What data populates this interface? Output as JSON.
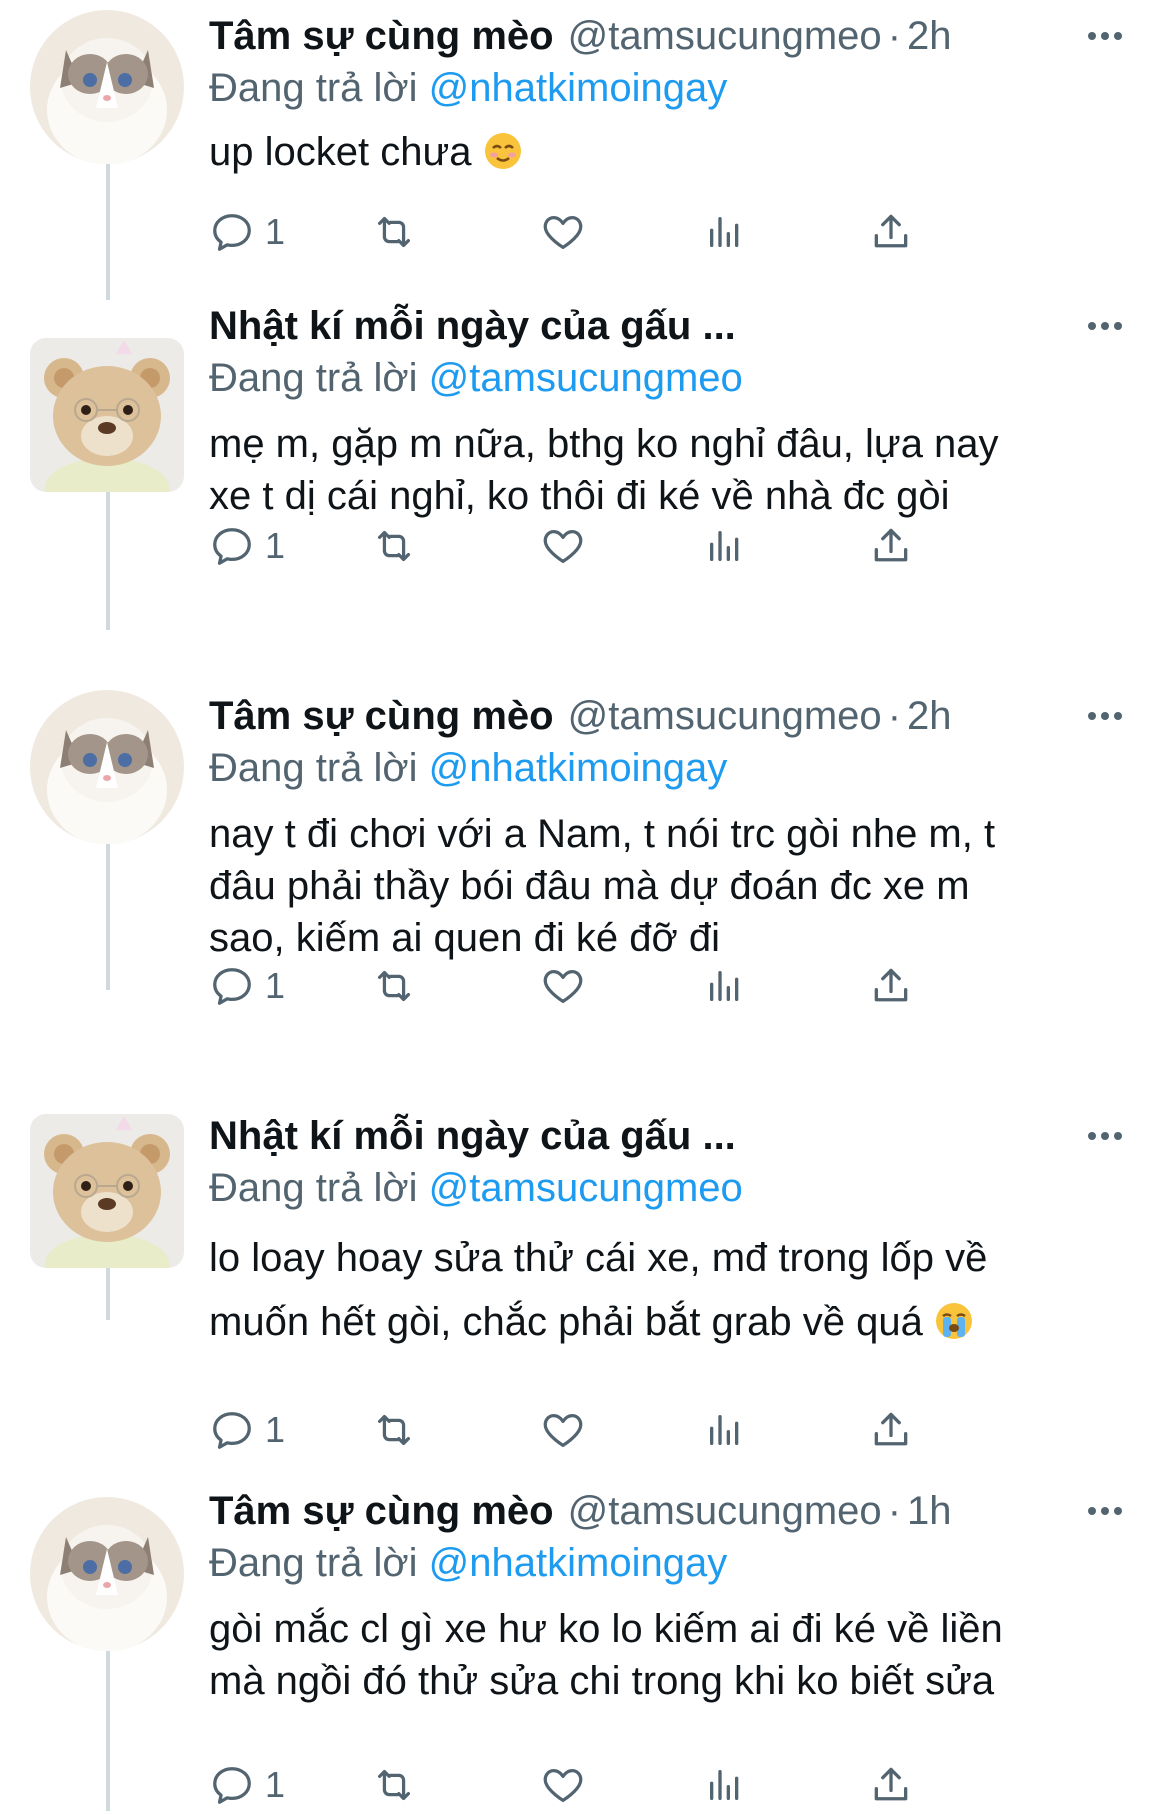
{
  "thread": [
    {
      "author_name": "Tâm sự cùng mèo",
      "author_handle": "@tamsucungmeo",
      "separator": "·",
      "time": "2h",
      "avatar": "cat",
      "reply_prefix": "Đang trả lời",
      "reply_to": "@nhatkimoingay",
      "text_lines": [
        "up locket chưa"
      ],
      "emoji": "smiling-blush-emoji",
      "reply_count": "1"
    },
    {
      "author_name": "Nhật kí mỗi ngày của gấu",
      "name_truncation": "...",
      "avatar": "bear",
      "reply_prefix": "Đang trả lời",
      "reply_to": "@tamsucungmeo",
      "text_lines": [
        "mẹ m, gặp m nữa, bthg ko nghỉ đâu, lựa nay",
        "xe t dị cái nghỉ, ko thôi đi ké về nhà đc gòi"
      ],
      "reply_count": "1"
    },
    {
      "author_name": "Tâm sự cùng mèo",
      "author_handle": "@tamsucungmeo",
      "separator": "·",
      "time": "2h",
      "avatar": "cat",
      "reply_prefix": "Đang trả lời",
      "reply_to": "@nhatkimoingay",
      "text_lines": [
        "nay t đi chơi với a Nam, t nói trc gòi nhe m, t",
        "đâu phải thầy bói đâu mà dự đoán đc xe m",
        "sao, kiếm ai quen đi ké đỡ đi"
      ],
      "reply_count": "1"
    },
    {
      "author_name": "Nhật kí mỗi ngày của gấu",
      "name_truncation": "...",
      "avatar": "bear",
      "reply_prefix": "Đang trả lời",
      "reply_to": "@tamsucungmeo",
      "text_lines": [
        "lo loay hoay sửa thử cái xe, mđ trong lốp về",
        "muốn hết gòi, chắc phải bắt grab về quá"
      ],
      "emoji": "loudly-crying-emoji",
      "reply_count": "1"
    },
    {
      "author_name": "Tâm sự cùng mèo",
      "author_handle": "@tamsucungmeo",
      "separator": "·",
      "time": "1h",
      "avatar": "cat",
      "reply_prefix": "Đang trả lời",
      "reply_to": "@nhatkimoingay",
      "text_lines": [
        "gòi mắc cl gì xe hư ko lo kiếm ai đi ké về liền",
        "mà ngồi đó thử sửa chi trong khi ko biết sửa"
      ],
      "reply_count": "1"
    }
  ],
  "icons": {
    "reply": "reply-bubble-icon",
    "retweet": "retweet-icon",
    "like": "heart-icon",
    "views": "analytics-bars-icon",
    "share": "share-upload-icon",
    "more": "more-dots-icon"
  },
  "colors": {
    "text": "#0f1419",
    "secondary": "#536471",
    "accent": "#1d9bf0",
    "thread_line": "#cfd9de"
  }
}
